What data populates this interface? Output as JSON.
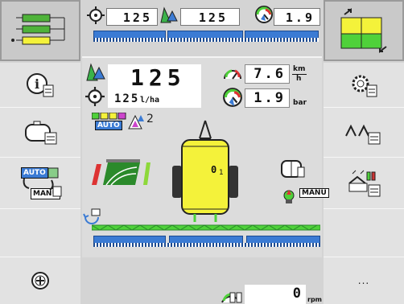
{
  "top": {
    "rate_target": "125",
    "rate_actual": "125",
    "pressure": "1.9"
  },
  "main": {
    "rate_value": "125",
    "rate_setpoint": "125",
    "rate_unit": "l/ha",
    "speed_value": "7.6",
    "speed_unit_top": "km",
    "speed_unit_bottom": "h",
    "pressure_value": "1.9",
    "pressure_unit": "bar",
    "auto_label": "AUTO",
    "sections_count": "2",
    "tank_label": "0",
    "tank_sub": "1",
    "manu_label": "MANU"
  },
  "left_softkeys": {
    "auto_label": "AUTO",
    "manu_label": "MANU"
  },
  "bottom": {
    "rpm_value": "0",
    "rpm_unit": "rpm",
    "more_label": "..."
  },
  "colors": {
    "boom_blue": "#3b7bd4",
    "tank_yellow": "#f4f23a",
    "boom_green": "#4fd13a"
  }
}
